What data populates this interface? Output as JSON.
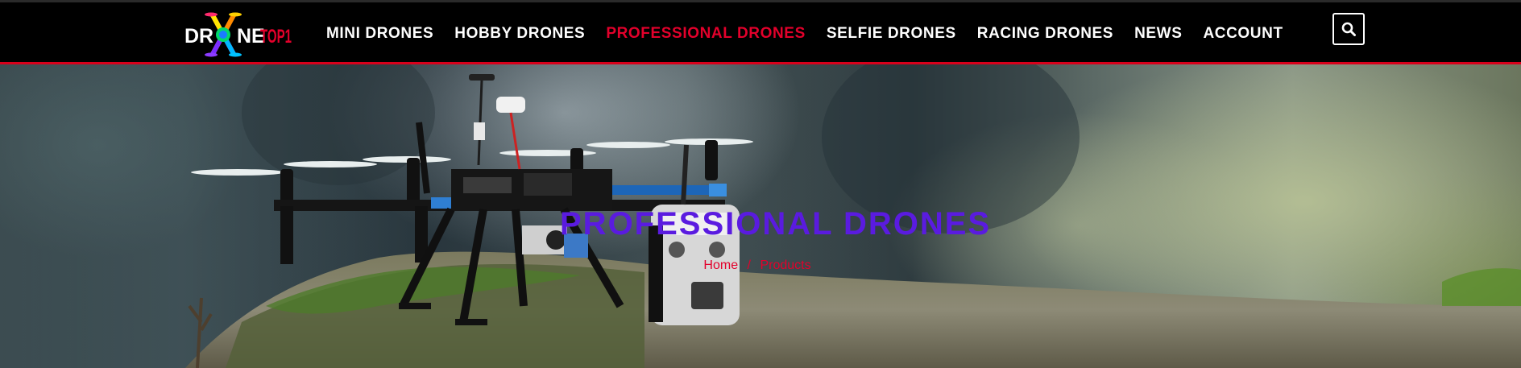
{
  "logo": {
    "text_part1": "DR",
    "text_part2": "NE",
    "text_part3": "TOP1",
    "accent_color": "#e3002b"
  },
  "nav": {
    "items": [
      {
        "label": "MINI DRONES",
        "active": false
      },
      {
        "label": "HOBBY DRONES",
        "active": false
      },
      {
        "label": "PROFESSIONAL DRONES",
        "active": true
      },
      {
        "label": "SELFIE DRONES",
        "active": false
      },
      {
        "label": "RACING DRONES",
        "active": false
      },
      {
        "label": "NEWS",
        "active": false
      },
      {
        "label": "ACCOUNT",
        "active": false
      }
    ],
    "search_icon": "search-icon"
  },
  "hero": {
    "title": "PROFESSIONAL DRONES",
    "breadcrumb": {
      "home": "Home",
      "separator": "/",
      "current": "Products"
    }
  },
  "colors": {
    "nav_background": "#000000",
    "nav_text": "#ffffff",
    "accent_red": "#e3002b",
    "title_purple": "#5a1be0"
  }
}
